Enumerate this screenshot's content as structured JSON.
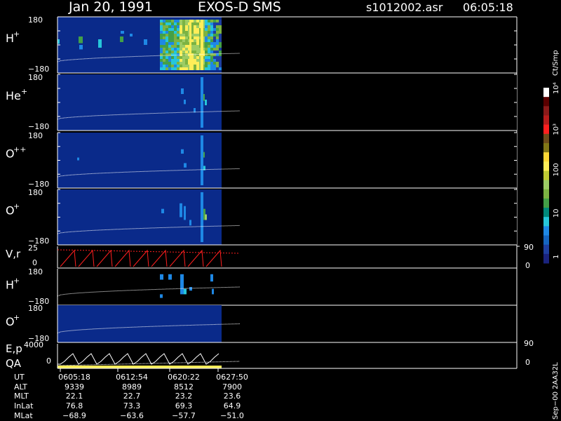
{
  "header": {
    "date": "Jan 20, 1991",
    "instrument": "EXOS-D SMS",
    "file": "s1012002.asr",
    "time": "06:05:18"
  },
  "colorbar": {
    "unit": "Ct/Smp",
    "tick_labels": [
      "1",
      "10",
      "100",
      "10³",
      "10⁴"
    ],
    "colors": [
      "#1a237e",
      "#1e3fa0",
      "#1565c0",
      "#1e88e5",
      "#26c6da",
      "#00897b",
      "#43a047",
      "#7cb342",
      "#9ccc65",
      "#c0ca33",
      "#ffee58",
      "#fdd835",
      "#827717",
      "#6d4c1b",
      "#ff1f1f",
      "#b71c1c",
      "#8b1a1a",
      "#5a0000",
      "#ffffff"
    ]
  },
  "panels": [
    {
      "label": "H",
      "sup": "+",
      "ymax": "180",
      "ymin": "−180"
    },
    {
      "label": "He",
      "sup": "+",
      "ymax": "180",
      "ymin": "−180"
    },
    {
      "label": "O",
      "sup": "++",
      "ymax": "180",
      "ymin": "−180"
    },
    {
      "label": "O",
      "sup": "+",
      "ymax": "180",
      "ymin": "−180"
    }
  ],
  "vr_panel": {
    "label": "V,r",
    "ymax": "25",
    "ymin": "0",
    "right_top": "90",
    "right_bottom": "0"
  },
  "low_panels": [
    {
      "label": "H",
      "sup": "+",
      "ymax": "180",
      "ymin": "−180"
    },
    {
      "label": "O",
      "sup": "+",
      "ymax": "180",
      "ymin": "−180"
    }
  ],
  "ep_panel": {
    "label1": "E,p",
    "label2": "QA",
    "ymax": "4000",
    "ymin": "0",
    "right_top": "90",
    "right_bottom": "0"
  },
  "footer_table": {
    "row_labels": [
      "UT",
      "ALT",
      "MLT",
      "InLat",
      "MLat"
    ],
    "columns": [
      [
        "0605:18",
        "9339",
        "22.1",
        "76.8",
        "−68.9"
      ],
      [
        "0612:54",
        "8989",
        "22.7",
        "73.3",
        "−63.6"
      ],
      [
        "0620:22",
        "8512",
        "23.2",
        "69.3",
        "−57.7"
      ],
      [
        "0627:50",
        "7900",
        "23.6",
        "64.9",
        "−51.0"
      ]
    ]
  },
  "side_note": "Sep−00  2AA32L",
  "chart_data": {
    "type": "heatmap",
    "title": "Jan 20, 1991   EXOS-D SMS",
    "x_ticks": [
      "0605:18",
      "0612:54",
      "0620:22",
      "0627:50"
    ],
    "y_range": [
      -180,
      180
    ],
    "color_scale": "log",
    "color_range": [
      1,
      10000
    ]
  }
}
